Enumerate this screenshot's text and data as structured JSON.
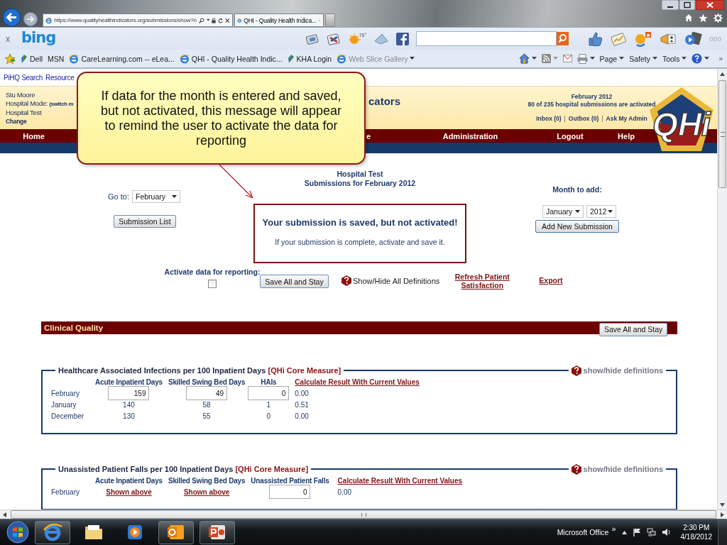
{
  "browser": {
    "address": "https://www.qualityhealthindicators.org/submissions/show?n",
    "tab": "QHI - Quality Health Indica...",
    "toolbar": {
      "close": "x",
      "brand": "bing",
      "weather": "76°",
      "more": "ooo"
    },
    "favorites": [
      {
        "kind": "site",
        "label": "Dell"
      },
      {
        "kind": "plain",
        "label": "MSN"
      },
      {
        "kind": "page",
        "label": "CareLearning.com -- eLea..."
      },
      {
        "kind": "page",
        "label": "QHI - Quality Health Indic..."
      },
      {
        "kind": "site",
        "label": "KHA Login"
      },
      {
        "kind": "gallery",
        "label": "Web Slice Gallery"
      }
    ],
    "commands": [
      "Page",
      "Safety",
      "Tools"
    ],
    "overflow": "»"
  },
  "page": {
    "links": [
      "PiHQ Search",
      "Resource"
    ],
    "user": {
      "name": "Stu Moore",
      "mode": "Hospital Mode:",
      "switch_link": "(switch m",
      "hospital": "Hospital Test",
      "change": "Change"
    },
    "site_title": "cators",
    "status": {
      "period": "February 2012",
      "summary": "80 of 235 hospital submissions are activated",
      "links": [
        {
          "kind": "link",
          "text": "Inbox (0)"
        },
        {
          "kind": "separator",
          "text": "|"
        },
        {
          "kind": "link",
          "text": "Outbox (0)"
        },
        {
          "kind": "separator",
          "text": "|"
        },
        {
          "kind": "link",
          "text": "Ask My Admin"
        }
      ]
    },
    "logo": "QHi",
    "nav": [
      "Home",
      "e",
      "Administration",
      "Logout",
      "Help"
    ]
  },
  "callout": "If data for the month is entered and saved, but not activated, this message will appear to remind the user to activate the data for reporting",
  "submission": {
    "heading": [
      "Hospital Test",
      "Submissions for February 2012"
    ],
    "goto": {
      "label": "Go to:",
      "value": "February"
    },
    "list_button": "Submission List",
    "message": {
      "title": "Your submission is saved, but not activated!",
      "body": "If your submission is complete, activate and save it."
    },
    "month_to_add": {
      "label": "Month to add:",
      "month": "January",
      "year": "2012",
      "button": "Add New Submission"
    },
    "activate": {
      "label": "Activate data for reporting:",
      "checked": false
    },
    "save_button": "Save All and Stay",
    "definitions_toggle": "Show/Hide All Definitions",
    "links": [
      "Refresh Patient Satisfaction",
      "Export"
    ]
  },
  "section": {
    "title": "Clinical Quality",
    "button": "Save All and Stay"
  },
  "measures": [
    {
      "title": "Healthcare Associated Infections per 100 Inpatient Days",
      "tag": "[QHi Core Measure]",
      "definitions": "show/hide definitions",
      "columns": [
        "Acute Inpatient Days",
        "Skilled Swing Bed Days",
        "HAIs"
      ],
      "calculate_link": "Calculate Result With Current Values",
      "rows": [
        {
          "month": "February",
          "cells": [
            {
              "kind": "input",
              "value": "159"
            },
            {
              "kind": "input",
              "value": "49"
            },
            {
              "kind": "input",
              "value": "0"
            }
          ],
          "result": "0.00"
        },
        {
          "month": "January",
          "cells": [
            {
              "kind": "text",
              "value": "140"
            },
            {
              "kind": "text",
              "value": "58"
            },
            {
              "kind": "text",
              "value": "1"
            }
          ],
          "result": "0.51"
        },
        {
          "month": "December",
          "cells": [
            {
              "kind": "text",
              "value": "130"
            },
            {
              "kind": "text",
              "value": "55"
            },
            {
              "kind": "text",
              "value": "0"
            }
          ],
          "result": "0.00"
        }
      ]
    },
    {
      "title": "Unassisted Patient Falls per 100 Inpatient Days",
      "tag": "[QHi Core Measure]",
      "definitions": "show/hide definitions",
      "columns": [
        "Acute Inpatient Days",
        "Skilled Swing Bed Days",
        "Unassisted Patient Falls"
      ],
      "calculate_link": "Calculate Result With Current Values",
      "rows": [
        {
          "month": "February",
          "cells": [
            {
              "kind": "link",
              "value": "Shown above"
            },
            {
              "kind": "link",
              "value": "Shown above"
            },
            {
              "kind": "input",
              "value": "0"
            }
          ],
          "result": "0.00"
        }
      ]
    }
  ],
  "taskbar": {
    "tray_label": "Microsoft Office",
    "tray_more": "»",
    "time": "2:30 PM",
    "date": "4/18/2012"
  }
}
